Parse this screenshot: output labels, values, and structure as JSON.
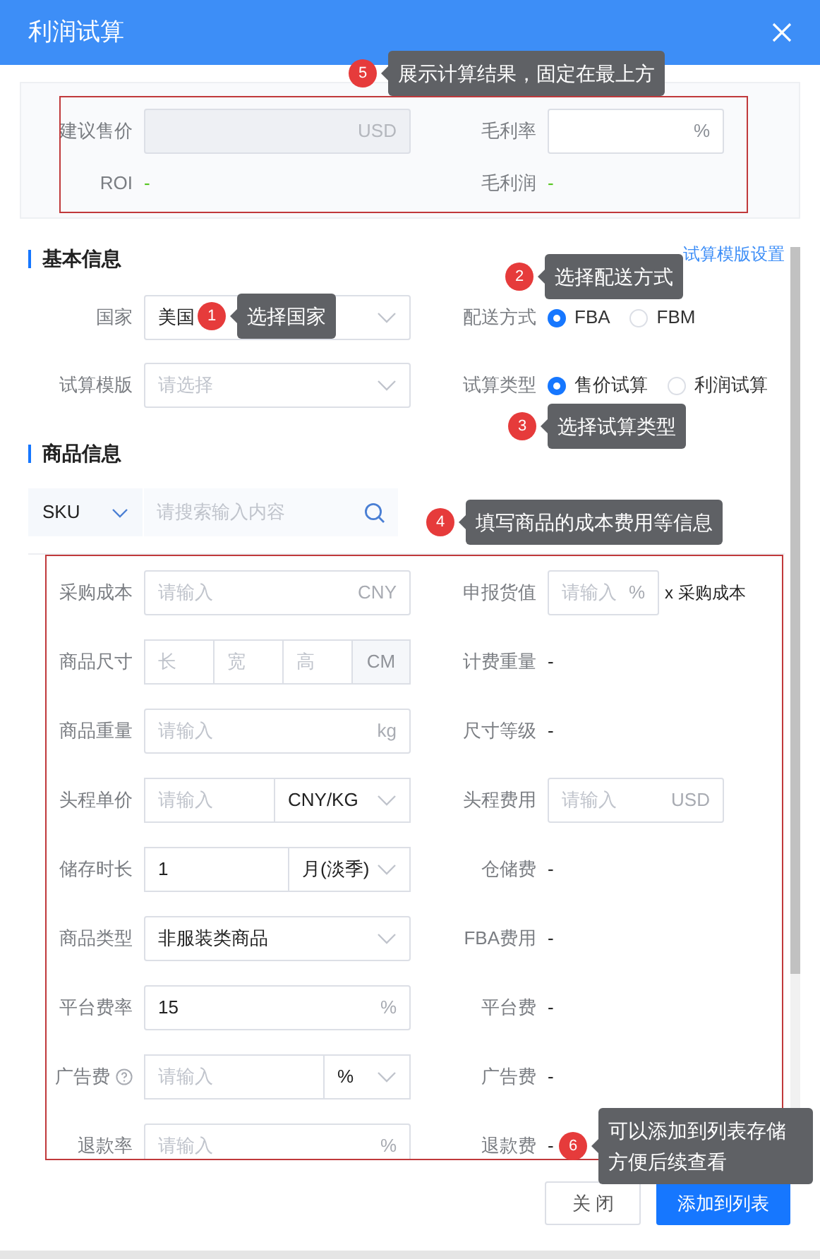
{
  "title": "利润试算",
  "result": {
    "fields": [
      {
        "label": "建议售价",
        "suffix": "USD",
        "disabled": true
      },
      {
        "label": "毛利率",
        "suffix": "%",
        "disabled": false
      }
    ],
    "values": [
      {
        "label": "ROI",
        "value": "-"
      },
      {
        "label": "毛利润",
        "value": "-"
      }
    ]
  },
  "basic": {
    "heading": "基本信息",
    "link": "试算模版设置",
    "rows": [
      {
        "left": {
          "label": "国家",
          "kind": "select",
          "value": "美国"
        },
        "right": {
          "label": "配送方式",
          "kind": "radio",
          "options": [
            {
              "label": "FBA",
              "selected": true
            },
            {
              "label": "FBM",
              "selected": false
            }
          ]
        }
      },
      {
        "left": {
          "label": "试算模版",
          "kind": "select",
          "placeholder": "请选择"
        },
        "right": {
          "label": "试算类型",
          "kind": "radio",
          "options": [
            {
              "label": "售价试算",
              "selected": true
            },
            {
              "label": "利润试算",
              "selected": false
            }
          ]
        }
      }
    ]
  },
  "product": {
    "heading": "商品信息",
    "search": {
      "selector": "SKU",
      "placeholder": "请搜索输入内容"
    },
    "rows": [
      {
        "left": {
          "label": "采购成本",
          "kind": "input",
          "placeholder": "请输入",
          "suffix": "CNY"
        },
        "right": {
          "label": "申报货值",
          "kind": "input",
          "placeholder": "请输入",
          "suffix": "%",
          "after": "x 采购成本"
        }
      },
      {
        "left": {
          "label": "商品尺寸",
          "kind": "dims",
          "placeholders": [
            "长",
            "宽",
            "高"
          ],
          "unit": "CM"
        },
        "right": {
          "label": "计费重量",
          "kind": "text",
          "value": "-"
        }
      },
      {
        "left": {
          "label": "商品重量",
          "kind": "input",
          "placeholder": "请输入",
          "suffix": "kg"
        },
        "right": {
          "label": "尺寸等级",
          "kind": "text",
          "value": "-"
        }
      },
      {
        "left": {
          "label": "头程单价",
          "kind": "input-select",
          "placeholder": "请输入",
          "option": "CNY/KG"
        },
        "right": {
          "label": "头程费用",
          "kind": "input",
          "placeholder": "请输入",
          "suffix": "USD"
        }
      },
      {
        "left": {
          "label": "储存时长",
          "kind": "input-select",
          "value": "1",
          "option": "月(淡季)"
        },
        "right": {
          "label": "仓储费",
          "kind": "text",
          "value": "-"
        }
      },
      {
        "left": {
          "label": "商品类型",
          "kind": "select",
          "value": "非服装类商品"
        },
        "right": {
          "label": "FBA费用",
          "kind": "text",
          "value": "-"
        }
      },
      {
        "left": {
          "label": "平台费率",
          "kind": "input",
          "value": "15",
          "suffix": "%"
        },
        "right": {
          "label": "平台费",
          "kind": "text",
          "value": "-"
        }
      },
      {
        "left": {
          "label": "广告费",
          "kind": "input-select",
          "placeholder": "请输入",
          "option": "%",
          "help": true
        },
        "right": {
          "label": "广告费",
          "kind": "text",
          "value": "-"
        }
      },
      {
        "left": {
          "label": "退款率",
          "kind": "input",
          "placeholder": "请输入",
          "suffix": "%"
        },
        "right": {
          "label": "退款费",
          "kind": "text",
          "value": "-"
        }
      }
    ]
  },
  "buttons": [
    {
      "label": "关 闭",
      "kind": "secondary"
    },
    {
      "label": "添加到列表",
      "kind": "primary"
    }
  ],
  "callouts": [
    {
      "number": "5",
      "text": "展示计算结果，固定在最上方"
    },
    {
      "number": "1",
      "text": "选择国家"
    },
    {
      "number": "2",
      "text": "选择配送方式"
    },
    {
      "number": "3",
      "text": "选择试算类型"
    },
    {
      "number": "4",
      "text": "填写商品的成本费用等信息"
    },
    {
      "number": "6",
      "text": "可以添加到列表存储方便后续查看"
    }
  ]
}
